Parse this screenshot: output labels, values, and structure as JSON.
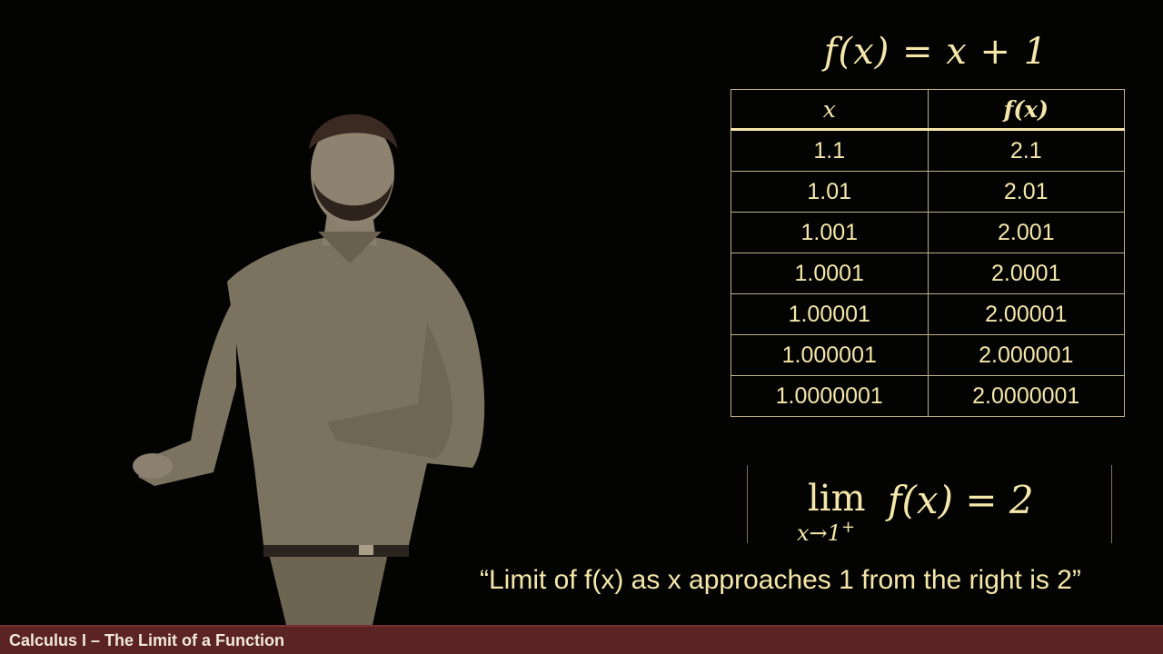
{
  "formula": "f(x) = x + 1",
  "table": {
    "headers": [
      "x",
      "f(x)"
    ],
    "rows": [
      [
        "1.1",
        "2.1"
      ],
      [
        "1.01",
        "2.01"
      ],
      [
        "1.001",
        "2.001"
      ],
      [
        "1.0001",
        "2.0001"
      ],
      [
        "1.00001",
        "2.00001"
      ],
      [
        "1.000001",
        "2.000001"
      ],
      [
        "1.0000001",
        "2.0000001"
      ]
    ]
  },
  "limit": {
    "lim": "lim",
    "sub_var": "x",
    "sub_arrow": "→",
    "sub_target": "1",
    "sub_sign": "+",
    "expression": "f(x) = 2"
  },
  "caption": "“Limit of f(x) as x approaches 1 from the right is 2”",
  "footer": {
    "title": "Calculus I – The Limit of a Function"
  }
}
